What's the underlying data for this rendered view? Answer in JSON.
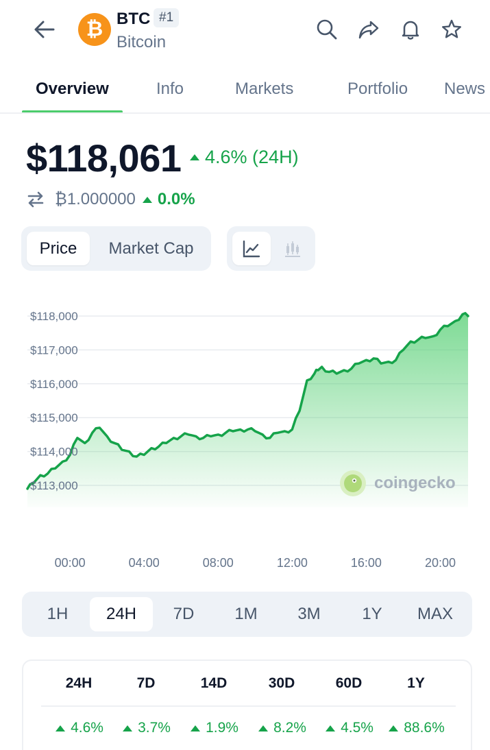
{
  "header": {
    "symbol": "BTC",
    "rank": "#1",
    "name": "Bitcoin",
    "logo_glyph": "₿",
    "icons": [
      "back-arrow-icon",
      "search-icon",
      "share-icon",
      "bell-icon",
      "star-icon"
    ]
  },
  "tabs": [
    {
      "label": "Overview",
      "active": true
    },
    {
      "label": "Info"
    },
    {
      "label": "Markets"
    },
    {
      "label": "Portfolio"
    },
    {
      "label": "News"
    }
  ],
  "price": {
    "value": "$118,061",
    "change": "4.6% (24H)",
    "btc_value": "₿1.000000",
    "btc_change": "0.0%"
  },
  "chart_toggle": {
    "options": [
      "Price",
      "Market Cap"
    ],
    "selected": "Price",
    "chart_types": [
      "line-chart-icon",
      "candlestick-chart-icon"
    ],
    "selected_type": "line-chart-icon"
  },
  "chart_data": {
    "type": "area",
    "title": "",
    "xlabel": "",
    "ylabel": "",
    "x_ticks": [
      "00:00",
      "04:00",
      "08:00",
      "12:00",
      "16:00",
      "20:00"
    ],
    "y_ticks": [
      "$113,000",
      "$114,000",
      "$115,000",
      "$116,000",
      "$117,000",
      "$118,000"
    ],
    "ylim": [
      112500,
      118300
    ],
    "xlim": [
      -2.3,
      21.5
    ],
    "grid": true,
    "series": [
      {
        "x": [
          -2.3,
          -2.0,
          -1.6,
          -1.2,
          -0.8,
          -0.4,
          0.0,
          0.4,
          0.8,
          1.2,
          1.6,
          2.0,
          2.4,
          2.8,
          3.2,
          3.6,
          4.0,
          4.4,
          4.8,
          5.2,
          5.6,
          6.0,
          6.4,
          6.8,
          7.2,
          7.6,
          8.0,
          8.4,
          8.8,
          9.2,
          9.6,
          10.0,
          10.4,
          10.8,
          11.2,
          11.6,
          12.0,
          12.4,
          12.8,
          13.2,
          13.4,
          13.6,
          14.0,
          14.4,
          14.8,
          15.2,
          15.6,
          16.0,
          16.4,
          16.8,
          17.2,
          17.6,
          18.0,
          18.4,
          18.8,
          19.2,
          19.6,
          20.0,
          20.4,
          20.8,
          21.2,
          21.5
        ],
        "y": [
          112900,
          113050,
          113300,
          113350,
          113500,
          113700,
          113900,
          114400,
          114250,
          114550,
          114700,
          114450,
          114250,
          114050,
          114000,
          113850,
          113900,
          114100,
          114150,
          114250,
          114400,
          114450,
          114500,
          114450,
          114400,
          114450,
          114500,
          114550,
          114600,
          114650,
          114650,
          114600,
          114500,
          114400,
          114550,
          114600,
          114650,
          115200,
          116100,
          116300,
          116400,
          116500,
          116350,
          116300,
          116400,
          116450,
          116600,
          116700,
          116750,
          116600,
          116650,
          116700,
          117000,
          117250,
          117300,
          117350,
          117400,
          117600,
          117700,
          117850,
          118050,
          118000
        ]
      }
    ],
    "line_color": "#16a34a",
    "fill_color": "#4bcc6b"
  },
  "watermark": "coingecko",
  "ranges": {
    "options": [
      "1H",
      "24H",
      "7D",
      "1M",
      "3M",
      "1Y",
      "MAX"
    ],
    "selected": "24H"
  },
  "performance": {
    "headers": [
      "24H",
      "7D",
      "14D",
      "30D",
      "60D",
      "1Y"
    ],
    "values": [
      "4.6%",
      "3.7%",
      "1.9%",
      "8.2%",
      "4.5%",
      "88.6%"
    ]
  },
  "colors": {
    "accent": "#4bcc6b",
    "positive": "#16a34a",
    "btc_orange": "#f7931a"
  }
}
